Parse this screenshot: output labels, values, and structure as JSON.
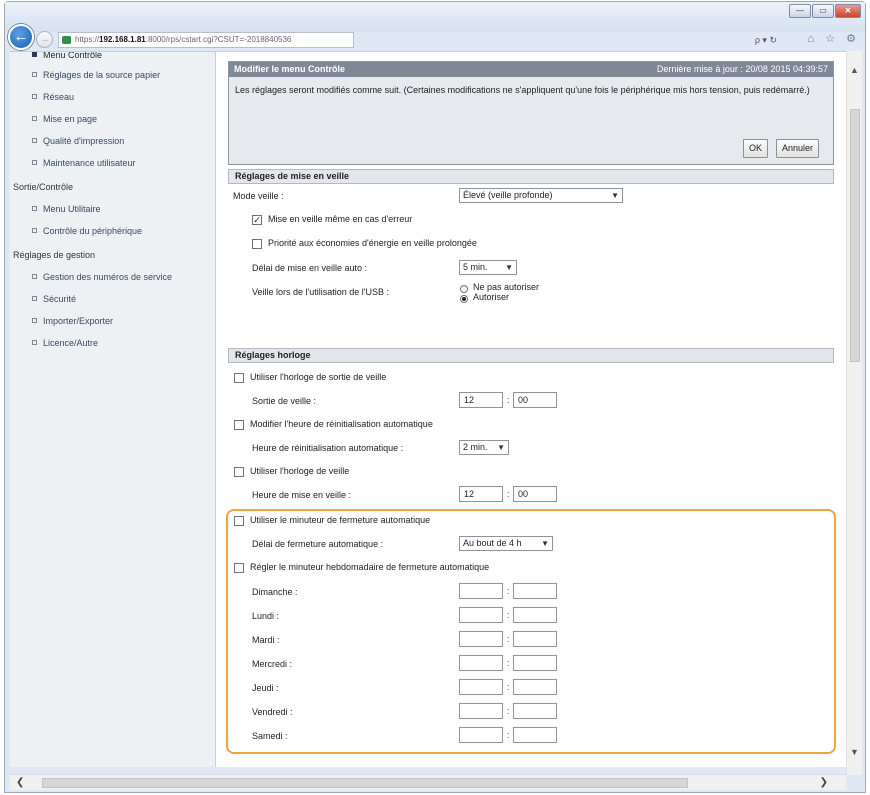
{
  "browser": {
    "url_prefix": "https://",
    "url_host": "192.168.1.81",
    "url_rest": ":8000/rps/cstart.cgi?CSUT=-2018840536",
    "search_icons": "ρ ▾ ↻",
    "tool_icons": "⌂ ☆ ⚙",
    "back_icon": "←",
    "forward_icon": "→",
    "min_label": "—",
    "max_label": "▭",
    "close_label": "✕"
  },
  "sidebar": {
    "items_top": [
      {
        "label": "Menu Contrôle"
      },
      {
        "label": "Réglages de la source papier"
      },
      {
        "label": "Réseau"
      },
      {
        "label": "Mise en page"
      },
      {
        "label": "Qualité d'impression"
      },
      {
        "label": "Maintenance utilisateur"
      }
    ],
    "group_sortie": "Sortie/Contrôle",
    "items_sortie": [
      {
        "label": "Menu Utilitaire"
      },
      {
        "label": "Contrôle du périphérique"
      }
    ],
    "group_gestion": "Réglages de gestion",
    "items_gestion": [
      {
        "label": "Gestion des numéros de service"
      },
      {
        "label": "Sécurité"
      },
      {
        "label": "Importer/Exporter"
      },
      {
        "label": "Licence/Autre"
      }
    ]
  },
  "panel": {
    "title": "Modifier le menu Contrôle",
    "last_update": "Dernière mise à jour : 20/08 2015 04:39:57",
    "notice": "Les réglages seront modifiés comme suit. (Certaines modifications ne s'appliquent qu'une fois le périphérique mis hors tension, puis redémarré.)",
    "ok": "OK",
    "cancel": "Annuler"
  },
  "veille": {
    "header": "Réglages de mise en veille",
    "mode_label": "Mode veille :",
    "mode_value": "Élevé (veille profonde)",
    "cb1_label": "Mise en veille même en cas d'erreur",
    "cb1_checked": "✓",
    "cb2_label": "Priorité aux économies d'énergie en veille prolongée",
    "delai_label": "Délai de mise en veille auto :",
    "delai_value": "5 min.",
    "usb_label": "Veille lors de l'utilisation de l'USB :",
    "usb_opt1": "Ne pas autoriser",
    "usb_opt2": "Autoriser"
  },
  "horloge": {
    "header": "Réglages horloge",
    "sortie_cb": "Utiliser l'horloge de sortie de veille",
    "sortie_label": "Sortie de veille :",
    "sortie_h": "12",
    "sortie_m": "00",
    "reinit_cb": "Modifier l'heure de réinitialisation automatique",
    "reinit_label": "Heure de réinitialisation automatique :",
    "reinit_value": "2 min.",
    "veille_cb": "Utiliser l'horloge de veille",
    "veille_label": "Heure de mise en veille :",
    "veille_h": "12",
    "veille_m": "00",
    "minuteur_cb": "Utiliser le minuteur de fermeture automatique",
    "minuteur_label": "Délai de fermeture automatique :",
    "minuteur_value": "Au bout de 4 h",
    "hebdo_cb": "Régler le minuteur hebdomadaire de fermeture automatique",
    "days": [
      "Dimanche :",
      "Lundi :",
      "Mardi :",
      "Mercredi :",
      "Jeudi :",
      "Vendredi :",
      "Samedi :"
    ]
  },
  "scroll": {
    "up": "▲",
    "down": "▼",
    "left": "❮",
    "right": "❯"
  }
}
